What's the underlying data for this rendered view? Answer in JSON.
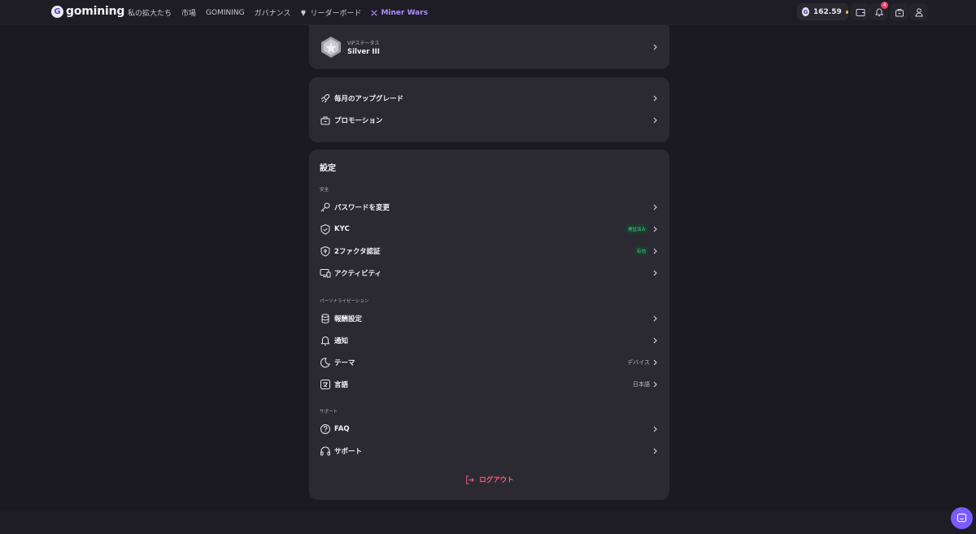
{
  "topbar": {
    "logo_text": "gomining",
    "nav": [
      "私の拡大たち",
      "市場",
      "GOMINING",
      "ガバナンス",
      "リーダーボード",
      "Miner Wars"
    ],
    "balance": "162.59",
    "notification_count": "4"
  },
  "vip": {
    "label": "VIPステータス",
    "value": "Silver III"
  },
  "upgrades": {
    "items": [
      "毎月のアップグレード",
      "プロモーション"
    ]
  },
  "settings": {
    "title": "設定",
    "security": {
      "label": "安全",
      "items": [
        "パスワードを変更",
        "KYC",
        "2ファクタ認証",
        "アクティビティ"
      ],
      "kyc_status": "検証済み",
      "twofa_status": "有効"
    },
    "personalization": {
      "label": "パーソナライゼーション",
      "items": [
        "報酬設定",
        "通知",
        "テーマ",
        "言語"
      ],
      "theme_value": "デバイス",
      "language_value": "日本語"
    },
    "support": {
      "label": "サポート",
      "items": [
        "FAQ",
        "サポート"
      ]
    },
    "logout": "ログアウト"
  }
}
